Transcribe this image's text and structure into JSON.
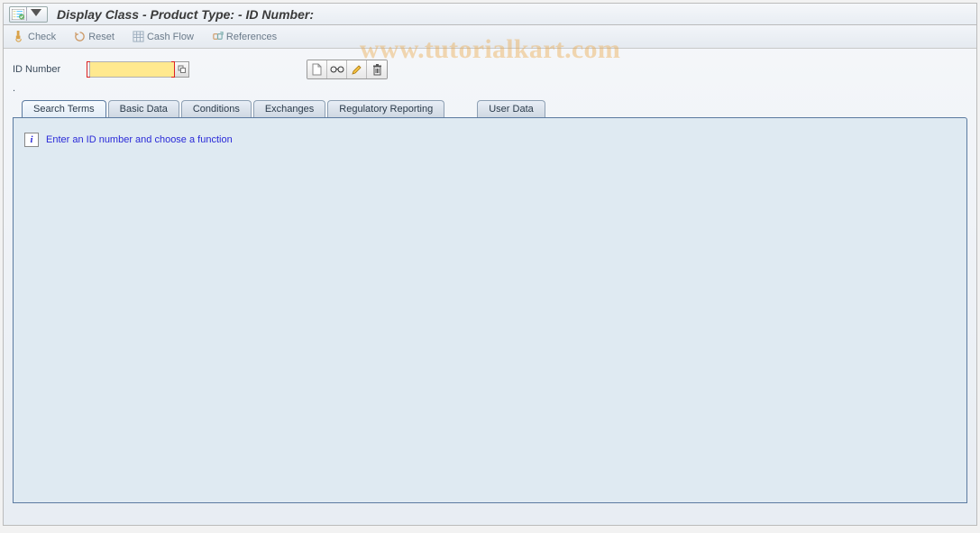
{
  "header": {
    "title": "Display Class - Product Type:  - ID Number:"
  },
  "toolbar": {
    "check": "Check",
    "reset": "Reset",
    "cashflow": "Cash Flow",
    "references": "References"
  },
  "form": {
    "id_label": "ID Number",
    "id_value": ""
  },
  "icon_buttons": {
    "create": "create",
    "display": "display",
    "edit": "edit",
    "delete": "delete"
  },
  "tabs": {
    "search_terms": "Search Terms",
    "basic_data": "Basic Data",
    "conditions": "Conditions",
    "exchanges": "Exchanges",
    "regulatory": "Regulatory Reporting",
    "user_data": "User Data"
  },
  "panel": {
    "info_message": "Enter an ID number and choose a function"
  },
  "watermark": "www.tutorialkart.com"
}
